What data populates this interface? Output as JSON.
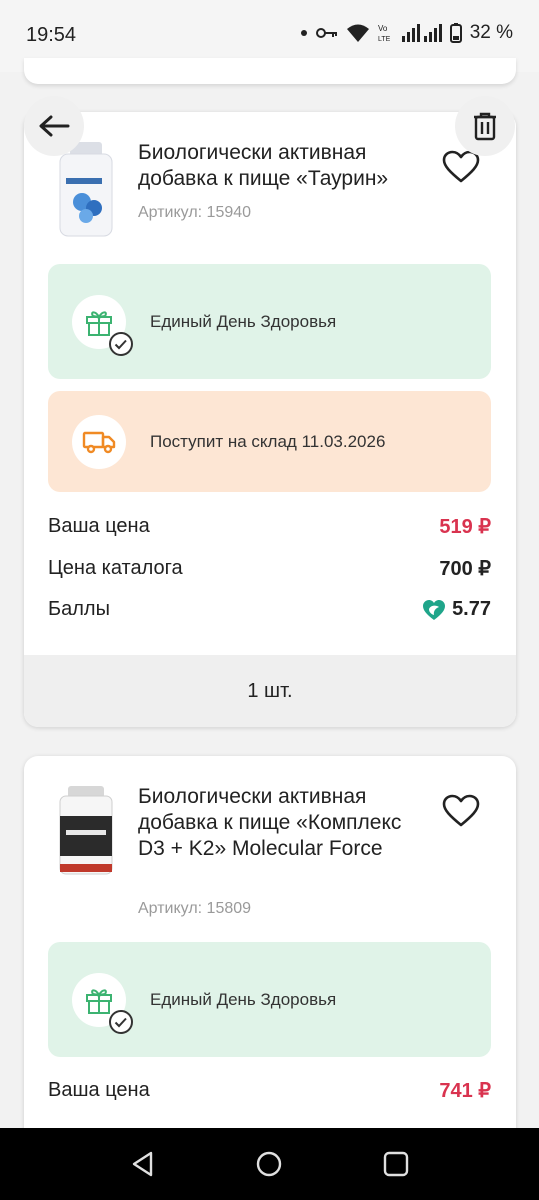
{
  "status_bar": {
    "time": "19:54",
    "battery": "32 %",
    "icons": [
      "dot-icon",
      "vpn-key-icon",
      "wifi-icon",
      "volte-icon",
      "signal-icon",
      "battery-icon"
    ]
  },
  "nav": {
    "back_icon": "arrow-left-icon",
    "delete_icon": "trash-icon"
  },
  "cart_items": [
    {
      "title": "Биологически активная добавка к пище «Таурин»",
      "sku": "Артикул: 15940",
      "promos": [
        {
          "text": "Единый День Здоровья",
          "icon": "gift-icon"
        },
        {
          "text": "Поступит на склад 11.03.2026",
          "icon": "truck-icon"
        }
      ],
      "prices": {
        "your_price_label": "Ваша цена",
        "your_price": "519 ₽",
        "catalog_price_label": "Цена каталога",
        "catalog_price": "700 ₽",
        "points_label": "Баллы",
        "points": "5.77"
      },
      "quantity": "1 шт."
    },
    {
      "title": "Биологически активная добавка к пище «Комплекс D3 + K2» Molecular Force",
      "sku": "Артикул: 15809",
      "promos": [
        {
          "text": "Единый День Здоровья",
          "icon": "gift-icon"
        }
      ],
      "prices": {
        "your_price_label": "Ваша цена",
        "your_price": "741 ₽"
      }
    }
  ],
  "colors": {
    "price_red": "#d9334f",
    "promo_green_bg": "#e0f3e8",
    "promo_orange_bg": "#fde6d4",
    "gift_green": "#3cb371",
    "truck_orange": "#f08a24",
    "points_teal": "#1fa58a"
  }
}
